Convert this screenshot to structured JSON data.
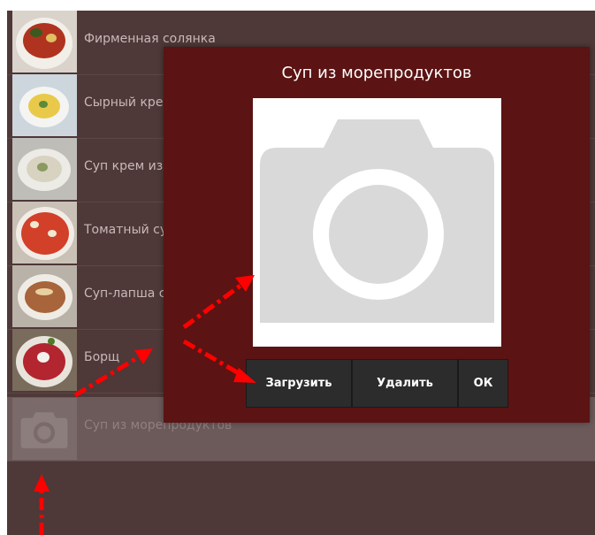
{
  "menu": {
    "items": [
      {
        "label": "Фирменная солянка"
      },
      {
        "label": "Сырный кре"
      },
      {
        "label": "Суп крем из"
      },
      {
        "label": "Томатный су"
      },
      {
        "label": "Суп-лапша с"
      },
      {
        "label": "Борщ"
      },
      {
        "label": "Суп из морепродуктов",
        "selected": true
      }
    ]
  },
  "dialog": {
    "title": "Суп из морепродуктов",
    "photo_icon": "camera-placeholder-icon",
    "buttons": {
      "upload": "Загрузить",
      "delete": "Удалить",
      "ok": "ОК"
    }
  },
  "colors": {
    "background": "#4e3838",
    "dialog": "#5b1313",
    "button": "#2c2c2c",
    "annotation_arrows": "#ff0000"
  }
}
